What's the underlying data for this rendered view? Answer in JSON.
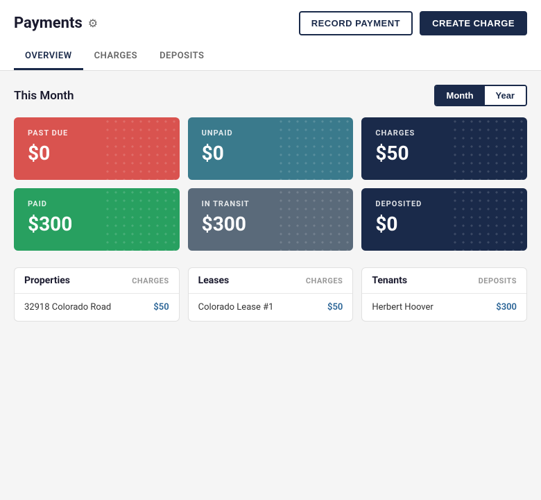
{
  "header": {
    "title": "Payments",
    "gear_icon": "⚙",
    "record_payment_label": "RECORD PAYMENT",
    "create_charge_label": "CREATE CHARGE"
  },
  "nav": {
    "tabs": [
      {
        "id": "overview",
        "label": "OVERVIEW",
        "active": true
      },
      {
        "id": "charges",
        "label": "CHARGES",
        "active": false
      },
      {
        "id": "deposits",
        "label": "DEPOSITS",
        "active": false
      }
    ]
  },
  "main": {
    "section_title": "This Month",
    "toggle": {
      "month_label": "Month",
      "year_label": "Year",
      "active": "month"
    },
    "cards": [
      {
        "id": "past-due",
        "label": "PAST DUE",
        "value": "$0",
        "color": "card-red"
      },
      {
        "id": "unpaid",
        "label": "UNPAID",
        "value": "$0",
        "color": "card-teal"
      },
      {
        "id": "charges",
        "label": "CHARGES",
        "value": "$50",
        "color": "card-navy"
      },
      {
        "id": "paid",
        "label": "PAID",
        "value": "$300",
        "color": "card-green"
      },
      {
        "id": "in-transit",
        "label": "IN TRANSIT",
        "value": "$300",
        "color": "card-gray"
      },
      {
        "id": "deposited",
        "label": "DEPOSITED",
        "value": "$0",
        "color": "card-dark-navy"
      }
    ],
    "tables": [
      {
        "id": "properties",
        "title": "Properties",
        "col_label": "CHARGES",
        "rows": [
          {
            "name": "32918 Colorado Road",
            "value": "$50"
          }
        ]
      },
      {
        "id": "leases",
        "title": "Leases",
        "col_label": "CHARGES",
        "rows": [
          {
            "name": "Colorado Lease #1",
            "value": "$50"
          }
        ]
      },
      {
        "id": "tenants",
        "title": "Tenants",
        "col_label": "DEPOSITS",
        "rows": [
          {
            "name": "Herbert Hoover",
            "value": "$300"
          }
        ]
      }
    ]
  }
}
